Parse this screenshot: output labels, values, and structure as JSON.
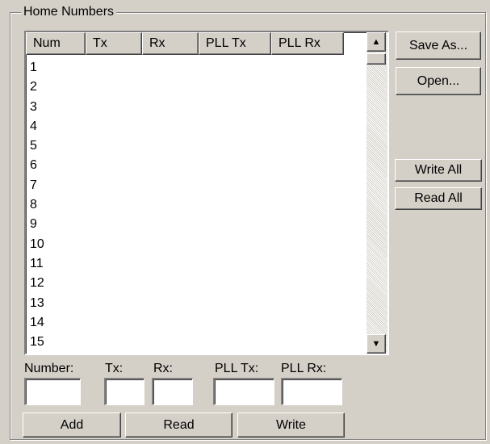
{
  "group": {
    "title": "Home Numbers"
  },
  "list": {
    "columns": [
      "Num",
      "Tx",
      "Rx",
      "PLL Tx",
      "PLL Rx"
    ],
    "rows": [
      "1",
      "2",
      "3",
      "4",
      "5",
      "6",
      "7",
      "8",
      "9",
      "10",
      "11",
      "12",
      "13",
      "14",
      "15"
    ]
  },
  "buttons": {
    "save_as": "Save As...",
    "open": "Open...",
    "write_all": "Write All",
    "read_all": "Read All",
    "add": "Add",
    "read": "Read",
    "write": "Write"
  },
  "fields": {
    "number": {
      "label": "Number:",
      "value": ""
    },
    "tx": {
      "label": "Tx:",
      "value": ""
    },
    "rx": {
      "label": "Rx:",
      "value": ""
    },
    "pll_tx": {
      "label": "PLL Tx:",
      "value": ""
    },
    "pll_rx": {
      "label": "PLL Rx:",
      "value": ""
    }
  },
  "icons": {
    "scroll_up": "scroll-up-arrow-icon",
    "scroll_down": "scroll-down-arrow-icon"
  }
}
